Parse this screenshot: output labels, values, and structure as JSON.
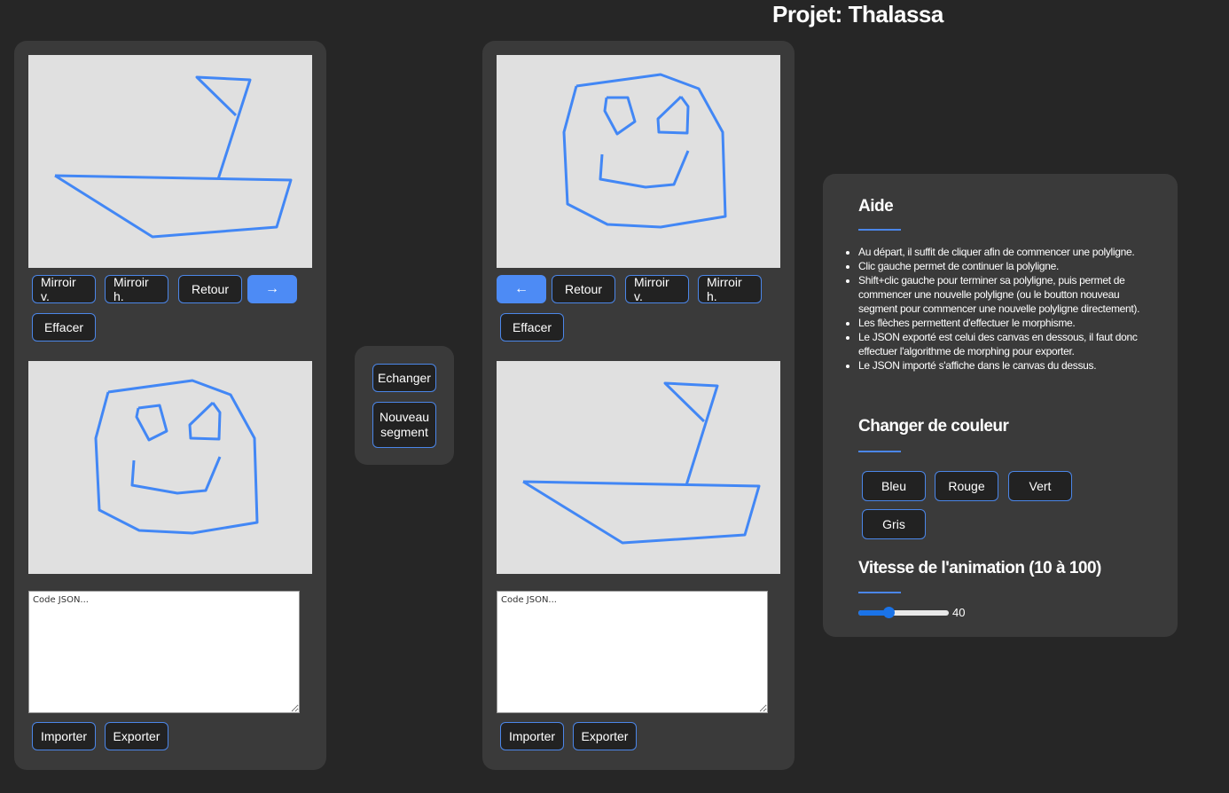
{
  "header": {
    "title": "Projet: Thalassa"
  },
  "left": {
    "buttons_top": {
      "mirror_v": "Mirroir v.",
      "mirror_h": "Mirroir h.",
      "back": "Retour",
      "arrow": "→",
      "clear": "Effacer"
    },
    "json": {
      "placeholder": "Code JSON..."
    },
    "import": "Importer",
    "export": "Exporter"
  },
  "middle": {
    "swap": "Echanger",
    "new_segment": "Nouveau segment"
  },
  "right": {
    "buttons_top": {
      "arrow": "←",
      "back": "Retour",
      "mirror_v": "Mirroir v.",
      "mirror_h": "Mirroir h.",
      "clear": "Effacer"
    },
    "json": {
      "placeholder": "Code JSON..."
    },
    "import": "Importer",
    "export": "Exporter"
  },
  "help": {
    "title": "Aide",
    "items": [
      "Au départ, il suffit de cliquer afin de commencer une polyligne.",
      "Clic gauche permet de continuer la polyligne.",
      "Shift+clic gauche pour terminer sa polyligne, puis permet de commencer une nouvelle polyligne (ou le boutton nouveau segment pour commencer une nouvelle polyligne directement).",
      "Les flèches permettent d'effectuer le morphisme.",
      "Le JSON exporté est celui des canvas en dessous, il faut donc effectuer l'algorithme de morphing pour exporter.",
      "Le JSON importé s'affiche dans le canvas du dessus."
    ],
    "color_title": "Changer de couleur",
    "colors": {
      "blue": "Bleu",
      "red": "Rouge",
      "green": "Vert",
      "gray": "Gris"
    },
    "speed_title": "Vitesse de l'animation (10 à 100)",
    "speed_value": "40",
    "speed_fraction": 0.333
  },
  "colors": {
    "stroke": "#4287f5",
    "accent": "#4b86e8",
    "primary_button": "#4d8bf5"
  }
}
